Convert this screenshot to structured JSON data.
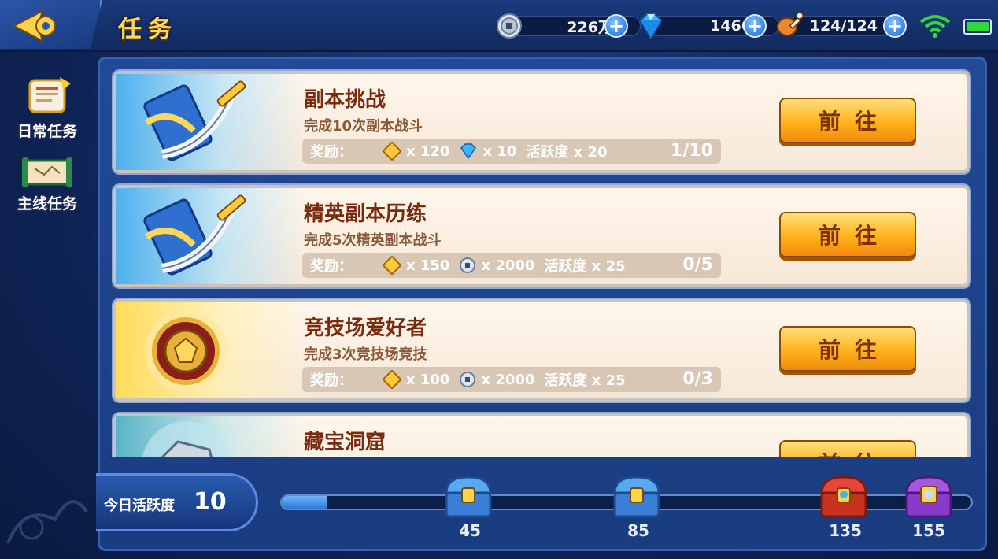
{
  "header": {
    "title": "任务",
    "resources": [
      {
        "icon": "coin-icon",
        "value": "226万"
      },
      {
        "icon": "diamond-icon",
        "value": "1466"
      },
      {
        "icon": "drumstick-icon",
        "value": "124/124"
      }
    ]
  },
  "sidebar": {
    "tabs": [
      {
        "label": "日常任务",
        "icon": "daily-scroll-icon",
        "active": true
      },
      {
        "label": "主线任务",
        "icon": "map-scroll-icon",
        "active": false
      }
    ]
  },
  "tasks": [
    {
      "title": "副本挑战",
      "desc": "完成10次副本战斗",
      "reward_label": "奖励：",
      "rewards": [
        {
          "icon": "ticket-icon",
          "text": "x 120"
        },
        {
          "icon": "diamond-icon",
          "text": "x 10"
        },
        {
          "icon": "",
          "text": "活跃度 x 20"
        }
      ],
      "progress": "1/10",
      "button": "前往",
      "art": "sword-icon"
    },
    {
      "title": "精英副本历练",
      "desc": "完成5次精英副本战斗",
      "reward_label": "奖励：",
      "rewards": [
        {
          "icon": "ticket-icon",
          "text": "x 150"
        },
        {
          "icon": "coin-icon",
          "text": "x 2000"
        },
        {
          "icon": "",
          "text": "活跃度 x 25"
        }
      ],
      "progress": "0/5",
      "button": "前往",
      "art": "sword-icon"
    },
    {
      "title": "竞技场爱好者",
      "desc": "完成3次竞技场竞技",
      "reward_label": "奖励：",
      "rewards": [
        {
          "icon": "ticket-icon",
          "text": "x 100"
        },
        {
          "icon": "coin-icon",
          "text": "x 2000"
        },
        {
          "icon": "",
          "text": "活跃度 x 25"
        }
      ],
      "progress": "0/3",
      "button": "前往",
      "art": "medal-icon"
    },
    {
      "title": "藏宝洞窟",
      "desc": "",
      "button": "前往",
      "art": "silver-ore-icon"
    }
  ],
  "activity": {
    "label": "今日活跃度",
    "value": "10",
    "progress_fraction": 0.065,
    "milestones": [
      {
        "value": "45",
        "chest": "blue-chest-icon"
      },
      {
        "value": "85",
        "chest": "blue-chest-icon"
      },
      {
        "value": "135",
        "chest": "red-chest-icon"
      },
      {
        "value": "155",
        "chest": "purple-chest-icon"
      }
    ]
  },
  "colors": {
    "title_gold": "#ffd75a",
    "task_title": "#7a2a0e",
    "button_orange": "#ffb21c",
    "battery_green": "#2fd93a"
  }
}
